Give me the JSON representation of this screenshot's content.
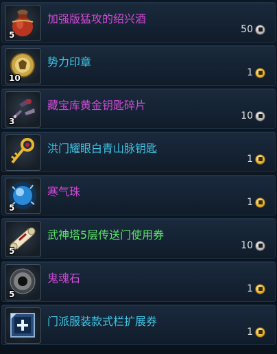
{
  "colors": {
    "magenta": "#d34bd8",
    "cyan": "#3fc6e6",
    "green": "#5de66a"
  },
  "items": [
    {
      "name": "加强版猛攻的绍兴酒",
      "qty": "5",
      "price": "50",
      "currency": "silver",
      "color": "#d34bd8",
      "icon": "wine-jar-icon"
    },
    {
      "name": "势力印章",
      "qty": "10",
      "price": "1",
      "currency": "gold",
      "color": "#3fc6e6",
      "icon": "seal-icon"
    },
    {
      "name": "藏宝库黄金钥匙碎片",
      "qty": "3",
      "price": "10",
      "currency": "silver",
      "color": "#d34bd8",
      "icon": "key-fragment-icon"
    },
    {
      "name": "洪门耀眼白青山脉钥匙",
      "qty": "",
      "price": "1",
      "currency": "gold",
      "color": "#3fc6e6",
      "icon": "golden-key-icon"
    },
    {
      "name": "寒气珠",
      "qty": "5",
      "price": "1",
      "currency": "gold",
      "color": "#d34bd8",
      "icon": "frost-orb-icon"
    },
    {
      "name": "武神塔5层传送门使用券",
      "qty": "5",
      "price": "10",
      "currency": "silver",
      "color": "#5de66a",
      "icon": "scroll-icon"
    },
    {
      "name": "鬼魂石",
      "qty": "5",
      "price": "1",
      "currency": "gold",
      "color": "#d34bd8",
      "icon": "ghost-stone-icon"
    },
    {
      "name": "门派服装款式栏扩展券",
      "qty": "",
      "price": "1",
      "currency": "gold",
      "color": "#3fc6e6",
      "icon": "expansion-ticket-icon"
    }
  ]
}
